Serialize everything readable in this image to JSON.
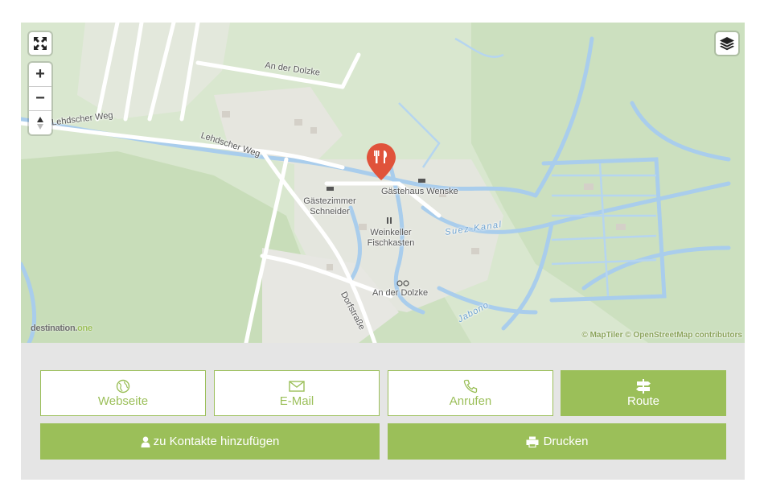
{
  "map": {
    "labels": {
      "an_der_dolzke_top": "An der Dolzke",
      "lehdscher_weg_1": "Lehdscher Weg",
      "lehdscher_weg_2": "Lehdscher Weg",
      "gaestehaus": "Gästehaus Wenske",
      "gaestezimmer": "Gästezimmer Schneider",
      "weinkeller": "Weinkeller Fischkasten",
      "suez_kanal": "Suez-Kanal",
      "an_der_dolzke_bottom": "An der Dolzke",
      "dorfstrasse": "Dorfstraße",
      "jabono": "Jabono"
    },
    "attribution": "© MapTiler © OpenStreetMap contributors",
    "logo_main": "destination.",
    "logo_accent": "one",
    "controls": {
      "zoom_in": "+",
      "zoom_out": "−"
    },
    "colors": {
      "water": "#a9cdec",
      "road": "#ffffff",
      "forest": "#c6dcb8",
      "marker": "#e0533b"
    }
  },
  "buttons": {
    "website": "Webseite",
    "email": "E-Mail",
    "call": "Anrufen",
    "route": "Route",
    "add_contact": "zu Kontakte hinzufügen",
    "print": "Drucken"
  },
  "colors": {
    "accent": "#9bbf59",
    "panel_bg": "#e5e5e5"
  }
}
